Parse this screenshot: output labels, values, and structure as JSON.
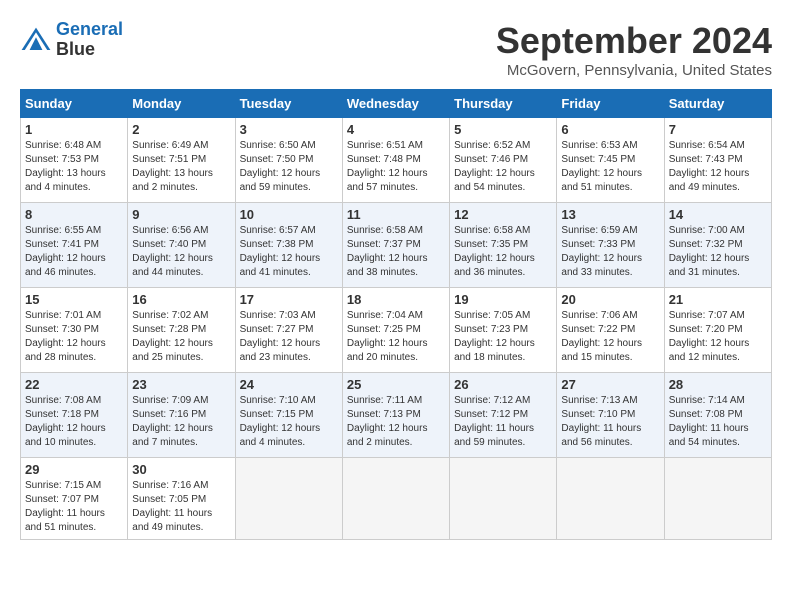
{
  "logo": {
    "line1": "General",
    "line2": "Blue"
  },
  "title": "September 2024",
  "subtitle": "McGovern, Pennsylvania, United States",
  "days_of_week": [
    "Sunday",
    "Monday",
    "Tuesday",
    "Wednesday",
    "Thursday",
    "Friday",
    "Saturday"
  ],
  "weeks": [
    [
      {
        "day": "1",
        "sunrise": "6:48 AM",
        "sunset": "7:53 PM",
        "daylight": "13 hours and 4 minutes."
      },
      {
        "day": "2",
        "sunrise": "6:49 AM",
        "sunset": "7:51 PM",
        "daylight": "13 hours and 2 minutes."
      },
      {
        "day": "3",
        "sunrise": "6:50 AM",
        "sunset": "7:50 PM",
        "daylight": "12 hours and 59 minutes."
      },
      {
        "day": "4",
        "sunrise": "6:51 AM",
        "sunset": "7:48 PM",
        "daylight": "12 hours and 57 minutes."
      },
      {
        "day": "5",
        "sunrise": "6:52 AM",
        "sunset": "7:46 PM",
        "daylight": "12 hours and 54 minutes."
      },
      {
        "day": "6",
        "sunrise": "6:53 AM",
        "sunset": "7:45 PM",
        "daylight": "12 hours and 51 minutes."
      },
      {
        "day": "7",
        "sunrise": "6:54 AM",
        "sunset": "7:43 PM",
        "daylight": "12 hours and 49 minutes."
      }
    ],
    [
      {
        "day": "8",
        "sunrise": "6:55 AM",
        "sunset": "7:41 PM",
        "daylight": "12 hours and 46 minutes."
      },
      {
        "day": "9",
        "sunrise": "6:56 AM",
        "sunset": "7:40 PM",
        "daylight": "12 hours and 44 minutes."
      },
      {
        "day": "10",
        "sunrise": "6:57 AM",
        "sunset": "7:38 PM",
        "daylight": "12 hours and 41 minutes."
      },
      {
        "day": "11",
        "sunrise": "6:58 AM",
        "sunset": "7:37 PM",
        "daylight": "12 hours and 38 minutes."
      },
      {
        "day": "12",
        "sunrise": "6:58 AM",
        "sunset": "7:35 PM",
        "daylight": "12 hours and 36 minutes."
      },
      {
        "day": "13",
        "sunrise": "6:59 AM",
        "sunset": "7:33 PM",
        "daylight": "12 hours and 33 minutes."
      },
      {
        "day": "14",
        "sunrise": "7:00 AM",
        "sunset": "7:32 PM",
        "daylight": "12 hours and 31 minutes."
      }
    ],
    [
      {
        "day": "15",
        "sunrise": "7:01 AM",
        "sunset": "7:30 PM",
        "daylight": "12 hours and 28 minutes."
      },
      {
        "day": "16",
        "sunrise": "7:02 AM",
        "sunset": "7:28 PM",
        "daylight": "12 hours and 25 minutes."
      },
      {
        "day": "17",
        "sunrise": "7:03 AM",
        "sunset": "7:27 PM",
        "daylight": "12 hours and 23 minutes."
      },
      {
        "day": "18",
        "sunrise": "7:04 AM",
        "sunset": "7:25 PM",
        "daylight": "12 hours and 20 minutes."
      },
      {
        "day": "19",
        "sunrise": "7:05 AM",
        "sunset": "7:23 PM",
        "daylight": "12 hours and 18 minutes."
      },
      {
        "day": "20",
        "sunrise": "7:06 AM",
        "sunset": "7:22 PM",
        "daylight": "12 hours and 15 minutes."
      },
      {
        "day": "21",
        "sunrise": "7:07 AM",
        "sunset": "7:20 PM",
        "daylight": "12 hours and 12 minutes."
      }
    ],
    [
      {
        "day": "22",
        "sunrise": "7:08 AM",
        "sunset": "7:18 PM",
        "daylight": "12 hours and 10 minutes."
      },
      {
        "day": "23",
        "sunrise": "7:09 AM",
        "sunset": "7:16 PM",
        "daylight": "12 hours and 7 minutes."
      },
      {
        "day": "24",
        "sunrise": "7:10 AM",
        "sunset": "7:15 PM",
        "daylight": "12 hours and 4 minutes."
      },
      {
        "day": "25",
        "sunrise": "7:11 AM",
        "sunset": "7:13 PM",
        "daylight": "12 hours and 2 minutes."
      },
      {
        "day": "26",
        "sunrise": "7:12 AM",
        "sunset": "7:12 PM",
        "daylight": "11 hours and 59 minutes."
      },
      {
        "day": "27",
        "sunrise": "7:13 AM",
        "sunset": "7:10 PM",
        "daylight": "11 hours and 56 minutes."
      },
      {
        "day": "28",
        "sunrise": "7:14 AM",
        "sunset": "7:08 PM",
        "daylight": "11 hours and 54 minutes."
      }
    ],
    [
      {
        "day": "29",
        "sunrise": "7:15 AM",
        "sunset": "7:07 PM",
        "daylight": "11 hours and 51 minutes."
      },
      {
        "day": "30",
        "sunrise": "7:16 AM",
        "sunset": "7:05 PM",
        "daylight": "11 hours and 49 minutes."
      },
      null,
      null,
      null,
      null,
      null
    ]
  ],
  "labels": {
    "sunrise": "Sunrise:",
    "sunset": "Sunset:",
    "daylight": "Daylight:"
  }
}
